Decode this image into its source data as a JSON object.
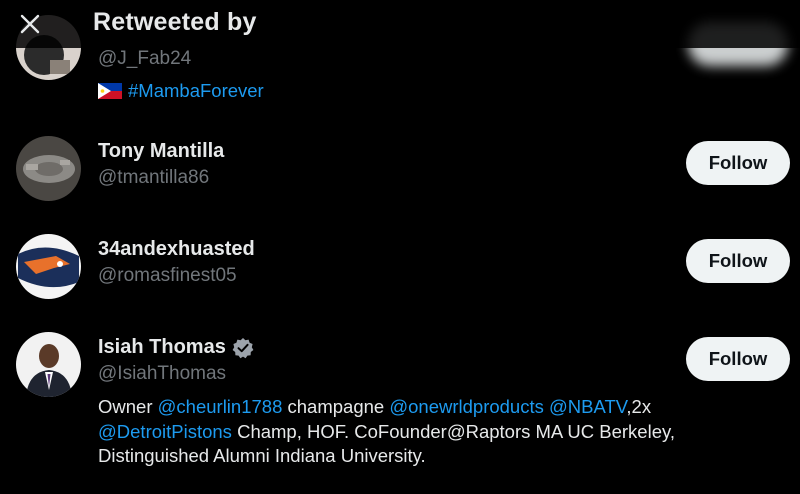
{
  "header": {
    "title": "Retweeted by"
  },
  "users": [
    {
      "handle": "@J_Fab24",
      "bio_hashtag": "#MambaForever",
      "flag": "philippines-flag-icon"
    },
    {
      "name": "Tony Mantilla",
      "handle": "@tmantilla86",
      "follow_label": "Follow"
    },
    {
      "name": "34andexhuasted",
      "handle": "@romasfinest05",
      "follow_label": "Follow"
    },
    {
      "name": "Isiah Thomas",
      "handle": "@IsiahThomas",
      "verified": true,
      "follow_label": "Follow",
      "bio": {
        "t1": "Owner ",
        "l1": "@cheurlin1788",
        "t2": " champagne ",
        "l2": "@onewrldproducts",
        "t3": " ",
        "l3": "@NBATV",
        "t4": ",2x",
        "l4": "@DetroitPistons",
        "t5": " Champ, HOF. CoFounder@Raptors MA UC Berkeley,",
        "t6": "Distinguished Alumni Indiana University."
      }
    }
  ],
  "colors": {
    "link": "#1d9bf0",
    "muted": "#71767b",
    "button_bg": "#eff3f4"
  }
}
